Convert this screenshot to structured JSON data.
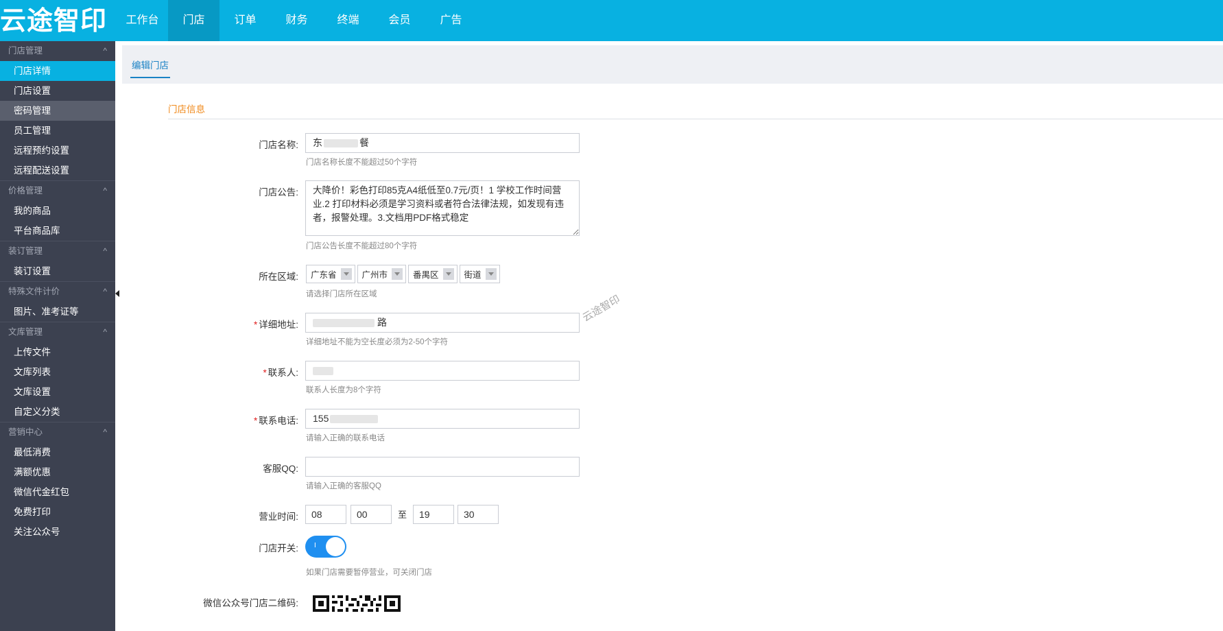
{
  "logo": "云途智印",
  "nav": [
    "工作台",
    "门店",
    "订单",
    "财务",
    "终端",
    "会员",
    "广告"
  ],
  "sidebar": [
    {
      "title": "门店管理",
      "items": [
        "门店详情",
        "门店设置",
        "密码管理",
        "员工管理",
        "远程预约设置",
        "远程配送设置"
      ]
    },
    {
      "title": "价格管理",
      "items": [
        "我的商品",
        "平台商品库"
      ]
    },
    {
      "title": "装订管理",
      "items": [
        "装订设置"
      ]
    },
    {
      "title": "特殊文件计价",
      "items": [
        "图片、准考证等"
      ]
    },
    {
      "title": "文库管理",
      "items": [
        "上传文件",
        "文库列表",
        "文库设置",
        "自定义分类"
      ]
    },
    {
      "title": "营销中心",
      "items": [
        "最低消费",
        "满额优惠",
        "微信代金红包",
        "免费打印",
        "关注公众号"
      ]
    }
  ],
  "tab": "编辑门店",
  "section_title": "门店信息",
  "form": {
    "name": {
      "label": "门店名称:",
      "value_prefix": "东",
      "value_suffix": "餐",
      "hint": "门店名称长度不能超过50个字符"
    },
    "notice": {
      "label": "门店公告:",
      "value": "大降价！彩色打印85克A4纸低至0.7元/页！1 学校工作时间营业.2 打印材料必须是学习资料或者符合法律法规，如发现有违者，报警处理。3.文档用PDF格式稳定",
      "hint": "门店公告长度不能超过80个字符"
    },
    "region": {
      "label": "所在区域:",
      "province": "广东省",
      "city": "广州市",
      "district": "番禺区",
      "street": "街道",
      "hint": "请选择门店所在区域"
    },
    "address": {
      "label": "详细地址:",
      "value_suffix": "路",
      "hint": "详细地址不能为空长度必须为2-50个字符"
    },
    "contact": {
      "label": "联系人:",
      "hint": "联系人长度为8个字符"
    },
    "phone": {
      "label": "联系电话:",
      "value_prefix": "155",
      "hint": "请输入正确的联系电话"
    },
    "qq": {
      "label": "客服QQ:",
      "value": "",
      "hint": "请输入正确的客服QQ"
    },
    "hours": {
      "label": "营业时间:",
      "start_h": "08",
      "start_m": "00",
      "to": "至",
      "end_h": "19",
      "end_m": "30"
    },
    "switch": {
      "label": "门店开关:",
      "on_text": "I",
      "hint": "如果门店需要暂停营业，可关闭门店"
    },
    "qr": {
      "label": "微信公众号门店二维码:"
    }
  },
  "watermark": "云途智印"
}
